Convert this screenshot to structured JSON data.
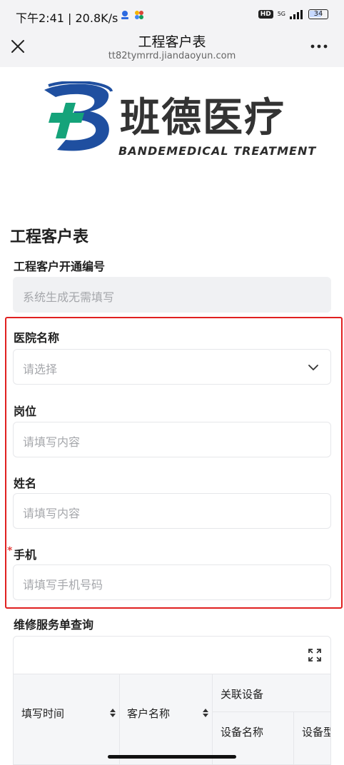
{
  "status_bar": {
    "time": "下午2:41 | 20.8K/s",
    "hd": "HD",
    "network": "5G",
    "battery": "34"
  },
  "nav": {
    "title": "工程客户表",
    "url": "tt82tymrrd.jiandaoyun.com"
  },
  "logo": {
    "brand_cn": "班德医疗",
    "brand_en": "BANDEMEDICAL TREATMENT"
  },
  "form": {
    "title": "工程客户表",
    "fields": [
      {
        "label": "工程客户开通编号",
        "placeholder": "系统生成无需填写",
        "required": false
      },
      {
        "label": "医院名称",
        "placeholder": "请选择",
        "required": false
      },
      {
        "label": "岗位",
        "placeholder": "请填写内容",
        "required": false
      },
      {
        "label": "姓名",
        "placeholder": "请填写内容",
        "required": false
      },
      {
        "label": "手机",
        "placeholder": "请填写手机号码",
        "required": true,
        "required_mark": "*"
      }
    ]
  },
  "subform": {
    "title": "维修服务单查询",
    "columns": {
      "fill_time": "填写时间",
      "customer_name": "客户名称",
      "related_device": "关联设备",
      "device_name": "设备名称",
      "device_model": "设备型"
    }
  },
  "colors": {
    "highlight_frame": "#e02020",
    "required_star": "#e64340",
    "logo_blue": "#1f4fa0",
    "logo_green": "#15a37a"
  }
}
